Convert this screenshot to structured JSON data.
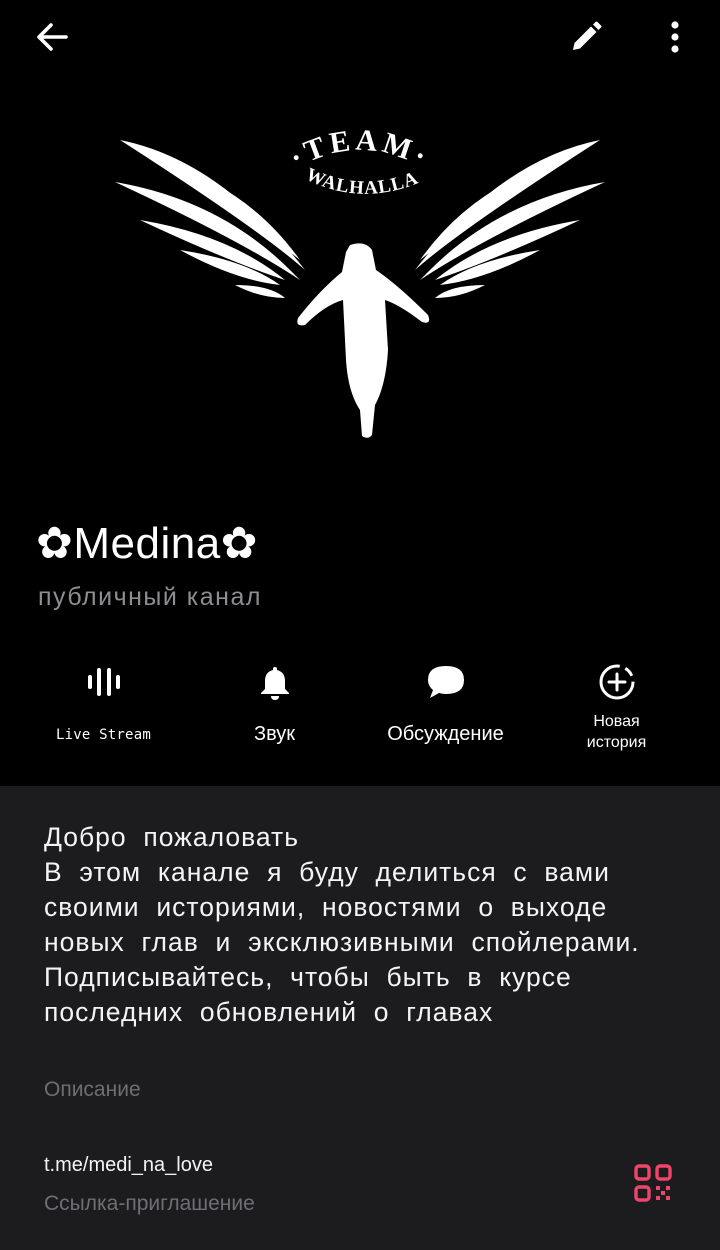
{
  "topbar": {
    "back_icon": "arrow-left-icon",
    "edit_icon": "pencil-icon",
    "more_icon": "more-vertical-icon"
  },
  "logo": {
    "text_top": "TEAM",
    "text_bottom": "WALHALLA",
    "icon": "winged-figure-logo"
  },
  "channel": {
    "name": "✿Medina✿",
    "type": "публичный  канал"
  },
  "actions": {
    "live": {
      "label": "Live Stream",
      "icon": "live-bars-icon"
    },
    "sound": {
      "label": "Звук",
      "icon": "bell-icon"
    },
    "discussion": {
      "label": "Обсуждение",
      "icon": "chat-bubble-icon"
    },
    "story": {
      "label_line1": "Новая",
      "label_line2": "история",
      "icon": "add-story-icon"
    }
  },
  "info": {
    "description": "Добро  пожаловать\nВ  этом  канале  я  буду  делиться  с  вами  своими  историями,  новостями  о  выходе  новых  глав  и  эксклюзивными  спойлерами.\nПодписывайтесь,  чтобы  быть  в  курсе  последних  обновлений  о  главах",
    "description_caption": "Описание",
    "link": "t.me/medi_na_love",
    "link_caption": "Ссылка-приглашение",
    "qr_icon": "qr-code-icon"
  },
  "colors": {
    "background": "#000000",
    "info_panel": "#1c1b1e",
    "secondary_text": "#8e8e92",
    "caption_text": "#6f6e73",
    "qr_accent": "#f0456b"
  }
}
